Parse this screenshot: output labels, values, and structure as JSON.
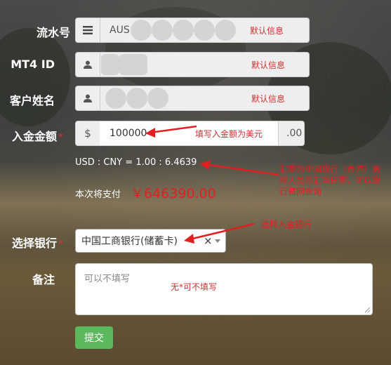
{
  "form": {
    "serial": {
      "label": "流水号",
      "value": "AUS",
      "hint": "默认信息",
      "icon": "list-icon"
    },
    "mt4": {
      "label": "MT4 ID",
      "hint": "默认信息",
      "icon": "user-icon"
    },
    "name": {
      "label": "客户姓名",
      "hint": "默认信息",
      "icon": "user-icon"
    },
    "amount": {
      "label": "入金金额",
      "required": "*",
      "prefix": "$",
      "value": "100000",
      "suffix": ".00"
    },
    "rate": {
      "text": "USD : CNY = 1.00 : 6.4639"
    },
    "pay": {
      "label": "本次将支付",
      "value": "￥646390.00"
    },
    "bank": {
      "label": "选择银行",
      "required": "*",
      "selected": "中国工商银行(储蓄卡)",
      "clear": "×"
    },
    "remark": {
      "label": "备注",
      "placeholder": "可以不填写"
    },
    "submit": {
      "label": "提交"
    }
  },
  "annotations": {
    "amount": "填写入金额为美元",
    "rate": "汇率为中国银行（香港）离岸人民币汇当日率，可以银行官网查询",
    "bank": "选择入金银行",
    "remark": "无*可不填写"
  },
  "colors": {
    "accent_red": "#e02020",
    "submit_green": "#5cb85c"
  }
}
